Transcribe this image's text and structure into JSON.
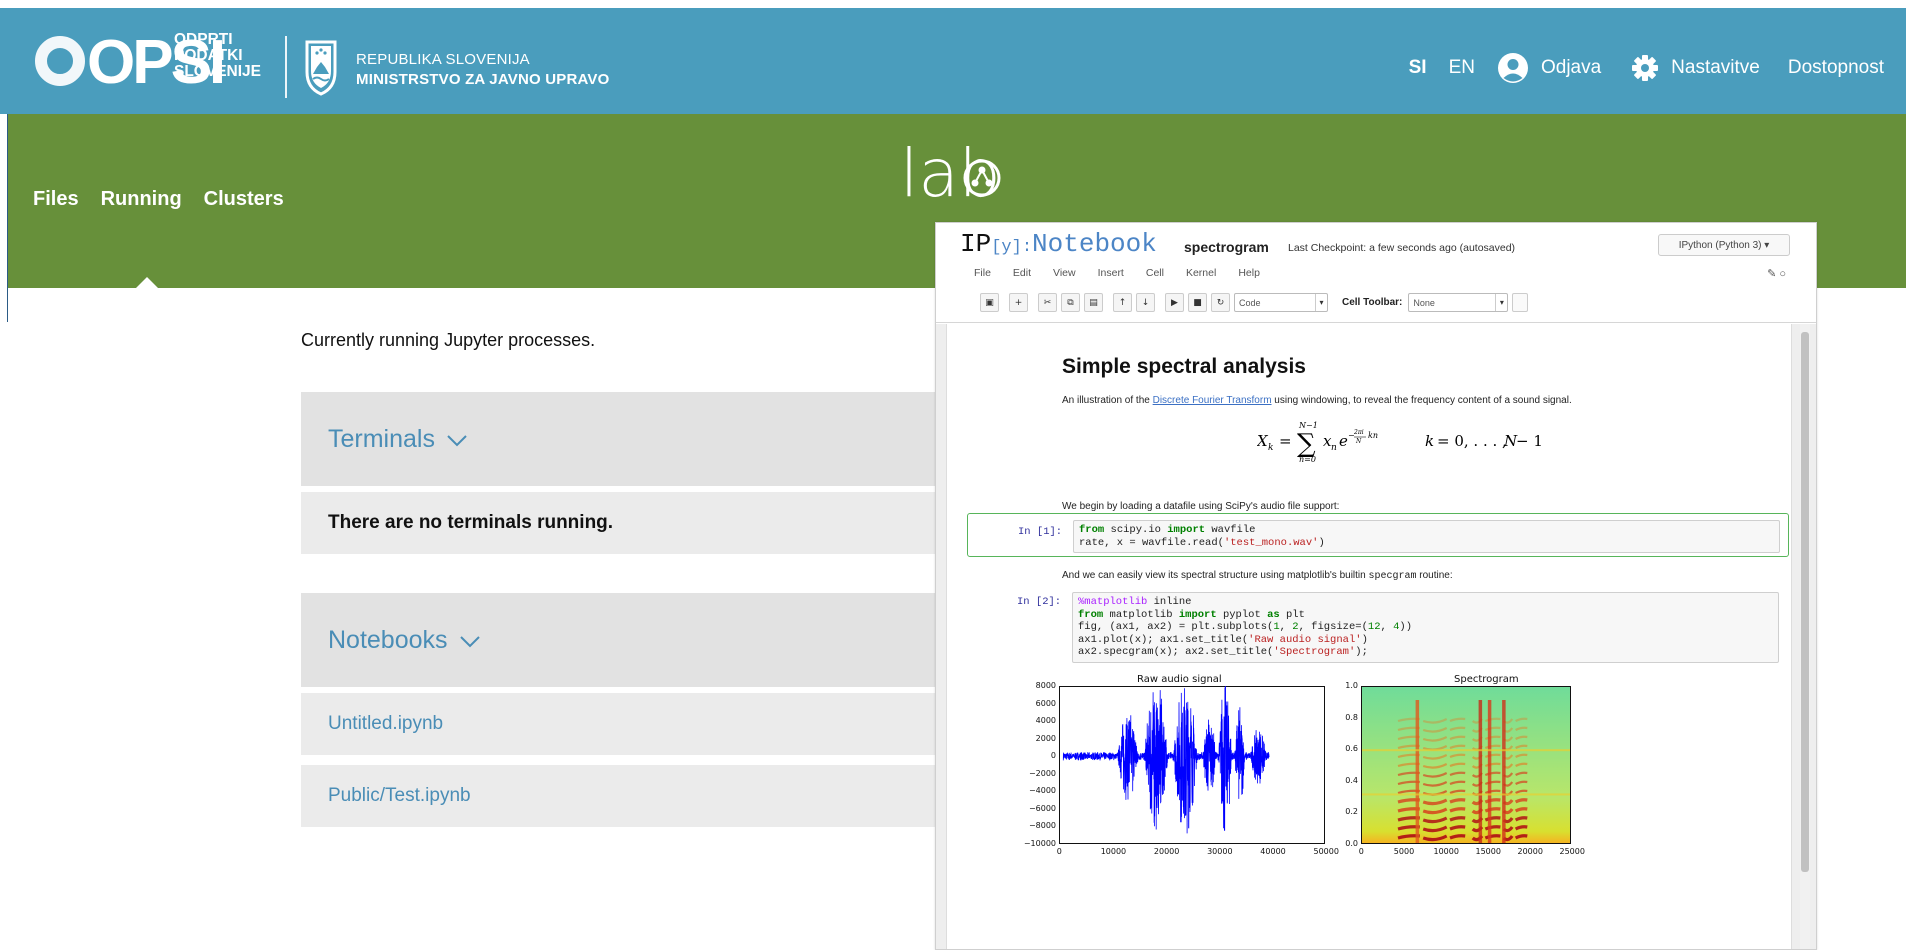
{
  "header": {
    "logo_text": "OPSI",
    "logo_sub": [
      "ODPRTI",
      "PODATKI",
      "SLOVENIJE"
    ],
    "ministry_line1": "REPUBLIKA SLOVENIJA",
    "ministry_line2": "MINISTRSTVO ZA JAVNO UPRAVO",
    "nav": {
      "lang_si": "SI",
      "lang_en": "EN",
      "logout": "Odjava",
      "settings": "Nastavitve",
      "accessibility": "Dostopnost"
    },
    "colors": {
      "blue": "#4a9dbd",
      "green": "#67903a"
    }
  },
  "subnav": {
    "files": "Files",
    "running": "Running",
    "clusters": "Clusters",
    "active": "Running"
  },
  "lab_logo_text": "lab",
  "running": {
    "intro": "Currently running Jupyter processes.",
    "terminals": {
      "title": "Terminals",
      "message": "There are no terminals running."
    },
    "notebooks": {
      "title": "Notebooks",
      "items": [
        "Untitled.ipynb",
        "Public/Test.ipynb"
      ]
    }
  },
  "notebook": {
    "brand": {
      "ip": "IP",
      "y": "[y]:",
      "word": "Notebook"
    },
    "name": "spectrogram",
    "checkpoint": "Last Checkpoint: a few seconds ago (autosaved)",
    "kernel": "IPython (Python 3) ▾",
    "menu": [
      "File",
      "Edit",
      "View",
      "Insert",
      "Cell",
      "Kernel",
      "Help"
    ],
    "toolbar": {
      "cell_type": "Code",
      "cell_toolbar_label": "Cell Toolbar:",
      "cell_toolbar_value": "None",
      "buttons": [
        "save-icon",
        "add-cell-icon",
        "cut-icon",
        "copy-icon",
        "paste-icon",
        "move-up-icon",
        "move-down-icon",
        "run-icon",
        "stop-icon",
        "restart-icon"
      ]
    },
    "md_title": "Simple spectral analysis",
    "md_intro_pre": "An illustration of the ",
    "md_intro_link": "Discrete Fourier Transform",
    "md_intro_post": " using windowing, to reveal the frequency content of a sound signal.",
    "md_load": "We begin by loading a datafile using SciPy's audio file support:",
    "md_view_pre": "And we can easily view its spectral structure using matplotlib's builtin ",
    "md_view_code": "specgram",
    "md_view_post": " routine:",
    "cell1": {
      "prompt": "In [1]:"
    },
    "cell2": {
      "prompt": "In [2]:"
    }
  },
  "chart_data": [
    {
      "type": "line",
      "title": "Raw audio signal",
      "xlim": [
        0,
        50000
      ],
      "ylim": [
        -10000,
        8000
      ],
      "x_ticks": [
        "0",
        "10000",
        "20000",
        "30000",
        "40000",
        "50000"
      ],
      "y_ticks": [
        "8000",
        "6000",
        "4000",
        "2000",
        "0",
        "−2000",
        "−4000",
        "−6000",
        "−8000",
        "−10000"
      ],
      "color": "#0000ff"
    },
    {
      "type": "heatmap",
      "title": "Spectrogram",
      "xlim": [
        0,
        25000
      ],
      "ylim": [
        0.0,
        1.0
      ],
      "x_ticks": [
        "0",
        "5000",
        "10000",
        "15000",
        "20000",
        "25000"
      ],
      "y_ticks": [
        "1.0",
        "0.8",
        "0.6",
        "0.4",
        "0.2",
        "0.0"
      ]
    }
  ]
}
